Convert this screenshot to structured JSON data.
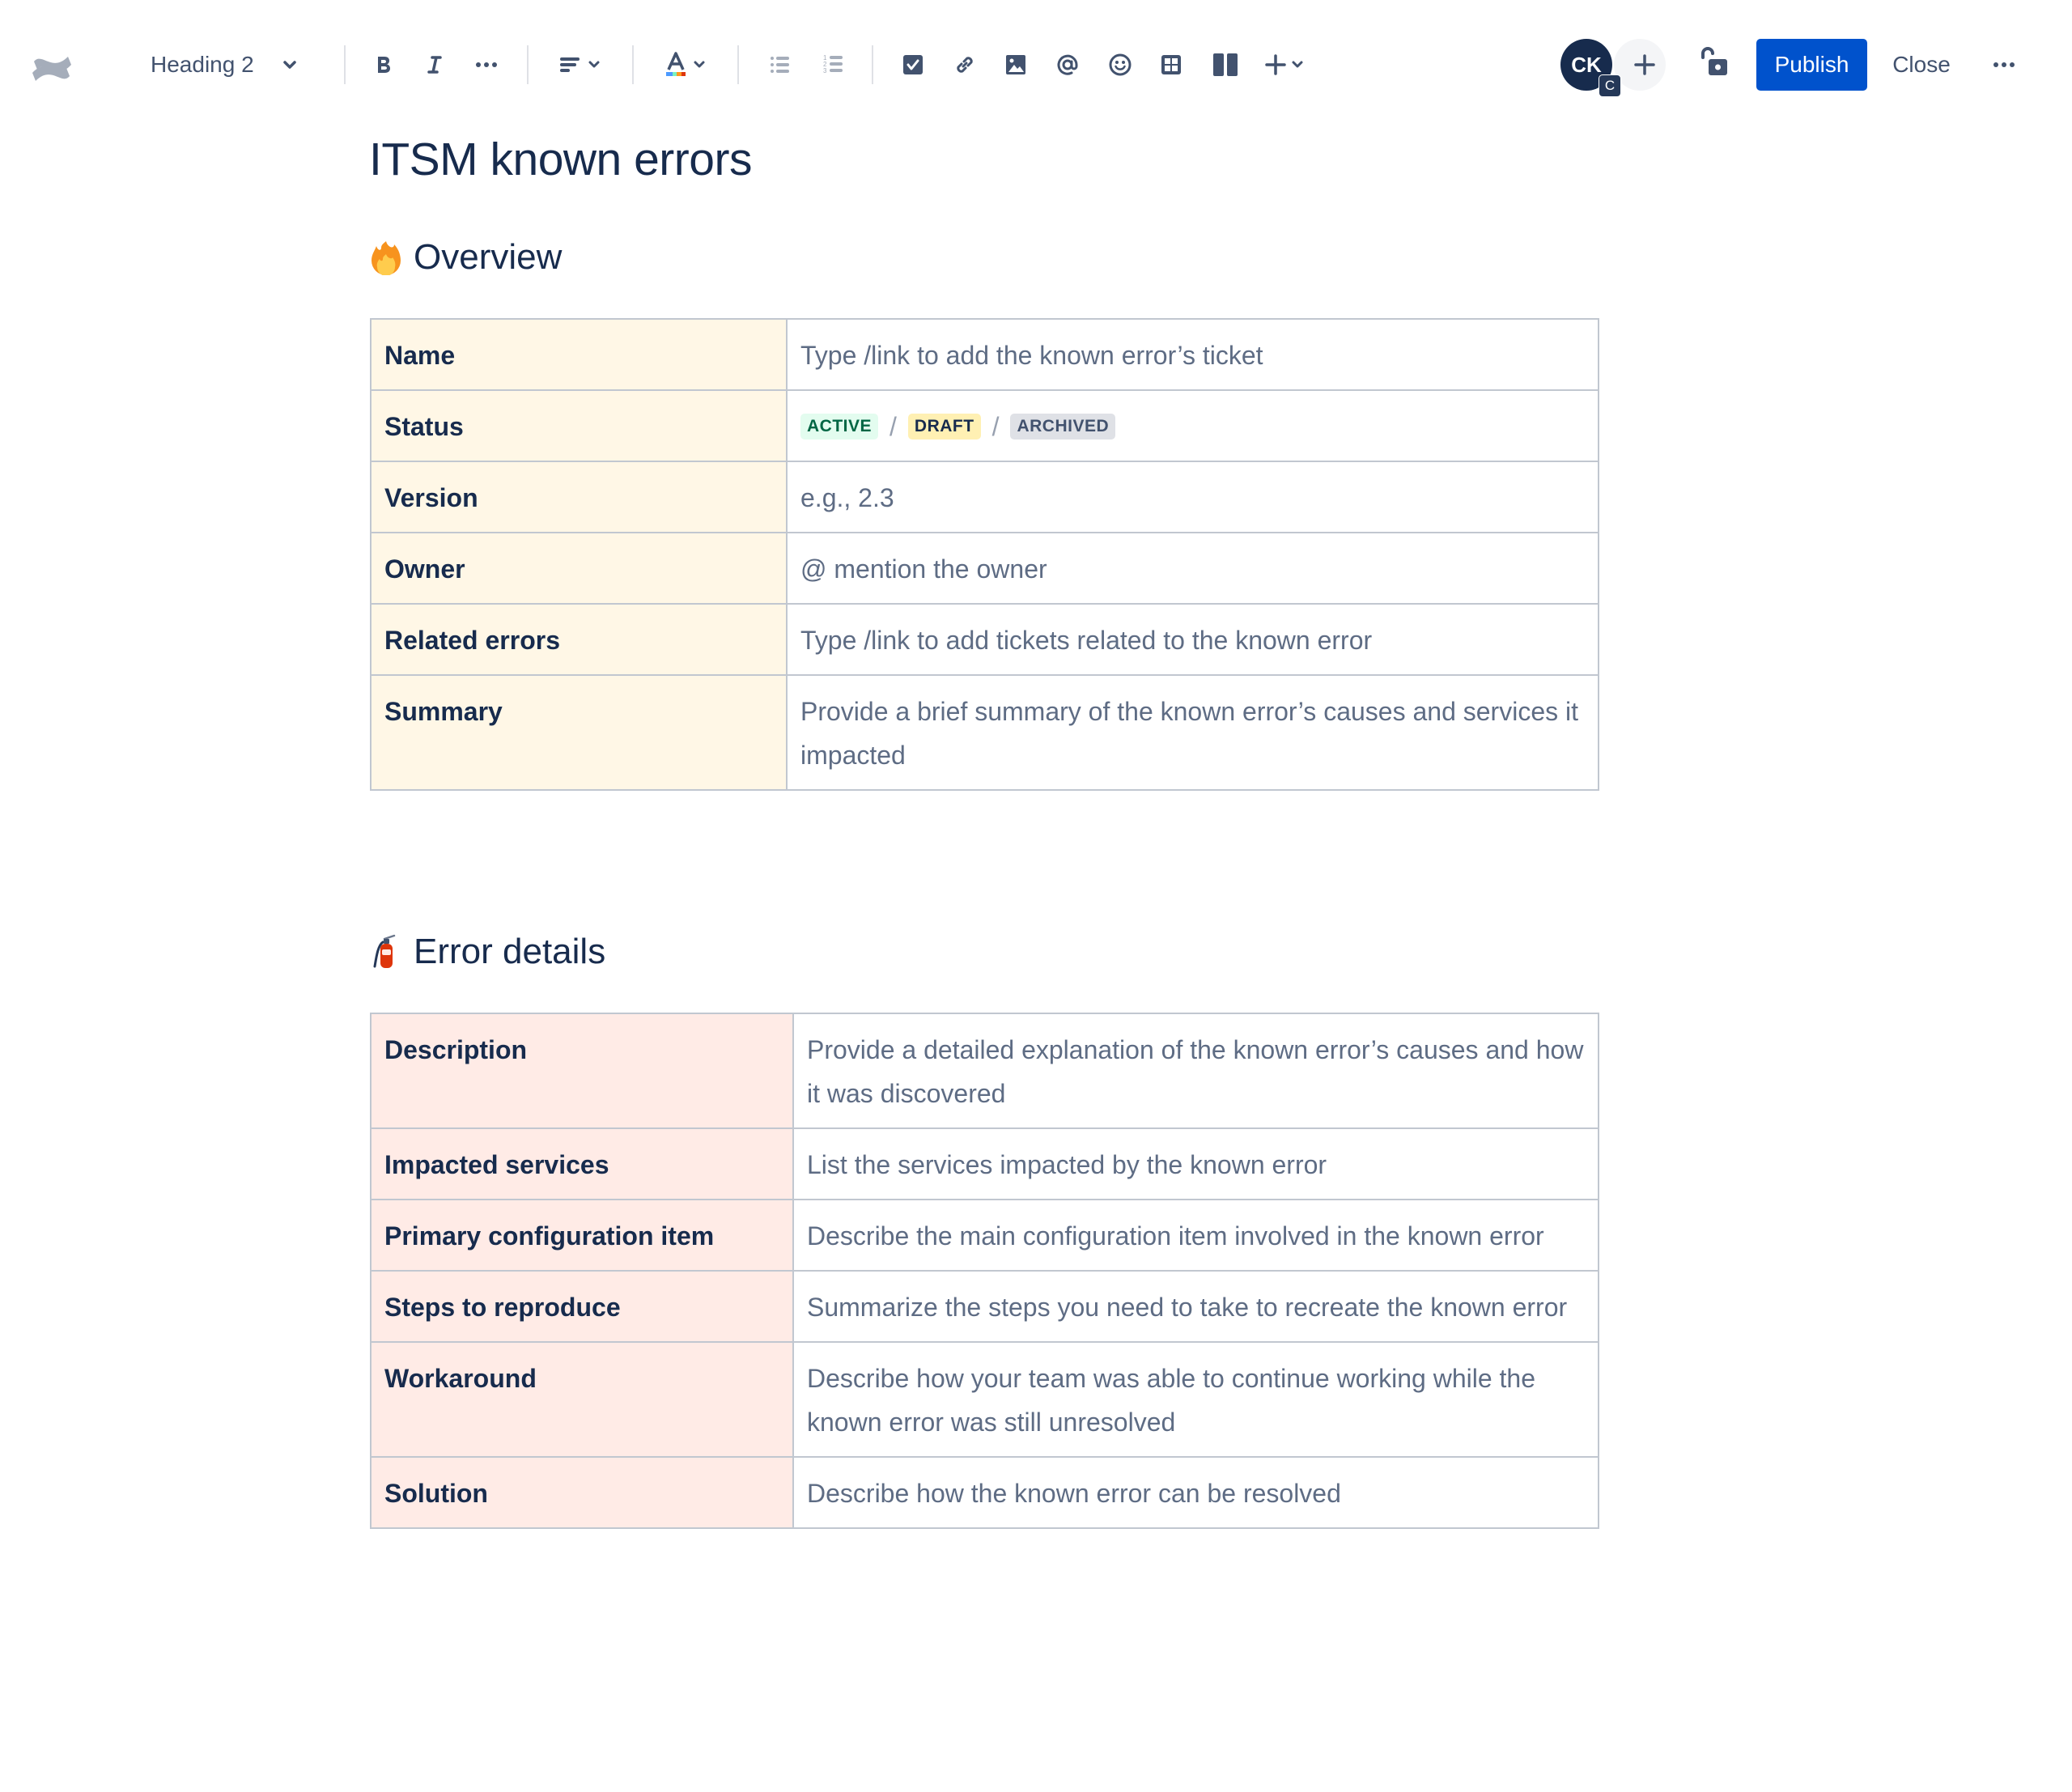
{
  "toolbar": {
    "logo_icon": "confluence-logo",
    "text_style": "Heading 2",
    "formatting": {
      "bold_icon": "bold-icon",
      "italic_icon": "italic-icon",
      "more_formatting_icon": "more-formatting-icon",
      "alignment_icon": "align-left-icon",
      "text_color_icon": "text-color-icon"
    },
    "lists": [
      "bullet-list-icon",
      "numbered-list-icon"
    ],
    "insert": [
      "action-item-icon",
      "link-icon",
      "image-icon",
      "mention-icon",
      "emoji-icon",
      "table-icon",
      "layout-icon",
      "insert-more-icon"
    ],
    "collaborator": {
      "initials": "CK",
      "badge": "C"
    },
    "invite_icon": "plus-icon",
    "restrictions_icon": "unlock-icon",
    "publish_label": "Publish",
    "close_label": "Close",
    "more_icon": "more-actions-icon",
    "colors": {
      "primary": "#0052CC",
      "icon": "#42526E",
      "avatar": "#172B4D"
    }
  },
  "page": {
    "title": "ITSM known errors",
    "sections": [
      {
        "emoji": "fire",
        "heading": "Overview",
        "key_color": "#FFF7E6",
        "rows": [
          {
            "key": "Name",
            "value": "Type /link to add the known error’s ticket"
          },
          {
            "key": "Status",
            "statuses": [
              {
                "label": "ACTIVE",
                "bg": "#E3FCEF",
                "fg": "#006644"
              },
              {
                "label": "DRAFT",
                "bg": "#FFF0B3",
                "fg": "#172B4D"
              },
              {
                "label": "ARCHIVED",
                "bg": "#DFE1E6",
                "fg": "#42526E"
              }
            ],
            "separator": "/"
          },
          {
            "key": "Version",
            "value": "e.g., 2.3"
          },
          {
            "key": "Owner",
            "value": "@ mention the owner"
          },
          {
            "key": "Related errors",
            "value": "Type /link to add tickets related to the known error"
          },
          {
            "key": "Summary",
            "value": "Provide a brief summary of the known error’s causes and services it impacted"
          }
        ]
      },
      {
        "emoji": "fire-extinguisher",
        "heading": "Error details",
        "key_color": "#FFEBE6",
        "rows": [
          {
            "key": "Description",
            "value": "Provide a detailed explanation of the known error’s causes and how it was discovered"
          },
          {
            "key": "Impacted services",
            "value": "List the services impacted by the known error"
          },
          {
            "key": "Primary configuration item",
            "value": "Describe the main configuration item involved in the known error"
          },
          {
            "key": "Steps to reproduce",
            "value": "Summarize the steps you need to take to recreate the known error"
          },
          {
            "key": "Workaround",
            "value": "Describe how your team was able to continue working while the known error was still unresolved"
          },
          {
            "key": "Solution",
            "value": "Describe how the known error can be resolved"
          }
        ]
      }
    ]
  }
}
